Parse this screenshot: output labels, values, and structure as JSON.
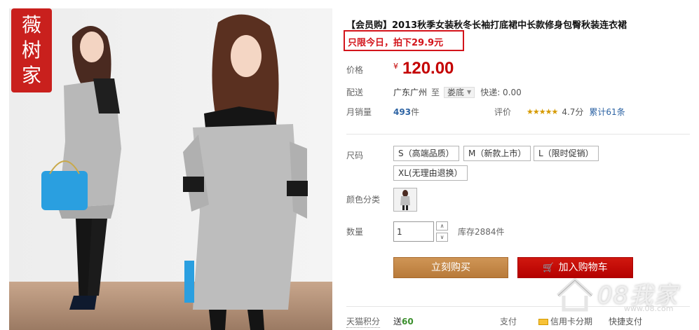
{
  "product": {
    "title": "【会员购】2013秋季女装秋冬长袖打底裙中长款修身包臀秋装连衣裙",
    "promo": "只限今日，拍下29.9元",
    "brand_badge": [
      "薇",
      "树",
      "家"
    ]
  },
  "price": {
    "label": "价格",
    "currency": "¥",
    "value": "120.00"
  },
  "shipping": {
    "label": "配送",
    "from": "广东广州",
    "to_word": "至",
    "dest": "娄底",
    "fee": "快递: 0.00"
  },
  "sales": {
    "label": "月销量",
    "count": "493",
    "unit": "件"
  },
  "rating": {
    "label": "评价",
    "stars": "★★★★★",
    "score": "4.7分",
    "cumulative": "累计61条"
  },
  "size": {
    "label": "尺码",
    "options": [
      "S（高端品质）",
      "M（新款上市）",
      "L（限时促销）",
      "XL(无理由退换）"
    ]
  },
  "color": {
    "label": "颜色分类"
  },
  "quantity": {
    "label": "数量",
    "value": "1",
    "up": "∧",
    "down": "∨",
    "stock": "库存2884件"
  },
  "actions": {
    "buy_now": "立刻购买",
    "add_cart": "加入购物车",
    "cart_icon": "🛒"
  },
  "footer": {
    "points_label": "天猫积分",
    "points_prefix": "送",
    "points_value": "60",
    "pay_label": "支付",
    "pay_credit": "信用卡分期",
    "pay_quick": "快捷支付"
  },
  "watermark": {
    "text": "08我家",
    "url": "www.08.com"
  },
  "colors": {
    "price": "#c40000",
    "promo": "#d3141b",
    "buy": "#c58a4b",
    "cart": "#c40000",
    "link": "#2e64a4"
  }
}
